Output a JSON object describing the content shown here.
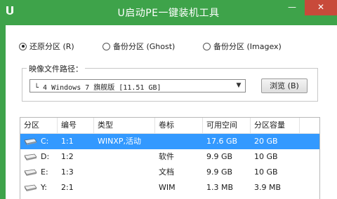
{
  "window": {
    "title": "U启动PE一键装机工具",
    "minimize_glyph": "—",
    "close_glyph": "✕",
    "accent_color": "#3ea34a",
    "close_color": "#c84a3a"
  },
  "mode_options": [
    {
      "label": "还原分区 (R)",
      "selected": true
    },
    {
      "label": "备份分区 (Ghost)",
      "selected": false
    },
    {
      "label": "备份分区 (Imagex)",
      "selected": false
    }
  ],
  "image_path": {
    "group_label": "映像文件路径：",
    "selected_value": "└ 4 Windows 7 旗舰版 [11.51 GB]",
    "browse_label": "浏览 (B)"
  },
  "partition_table": {
    "columns": [
      "分区",
      "编号",
      "类型",
      "卷标",
      "可用空间",
      "分区容量"
    ],
    "rows": [
      {
        "drive": "C:",
        "number": "1:1",
        "type": "WINXP,活动",
        "label": "",
        "free": "17.6 GB",
        "size": "20 GB",
        "selected": true
      },
      {
        "drive": "D:",
        "number": "1:2",
        "type": "",
        "label": "软件",
        "free": "9.9 GB",
        "size": "10 GB",
        "selected": false
      },
      {
        "drive": "E:",
        "number": "1:3",
        "type": "",
        "label": "文档",
        "free": "9.9 GB",
        "size": "10 GB",
        "selected": false
      },
      {
        "drive": "Y:",
        "number": "2:1",
        "type": "",
        "label": "WIM",
        "free": "1.3 MB",
        "size": "3.9 MB",
        "selected": false
      }
    ]
  },
  "icons": {
    "app": "u-logo-icon",
    "disk": "hard-disk-icon",
    "dropdown": "chevron-down-icon"
  }
}
